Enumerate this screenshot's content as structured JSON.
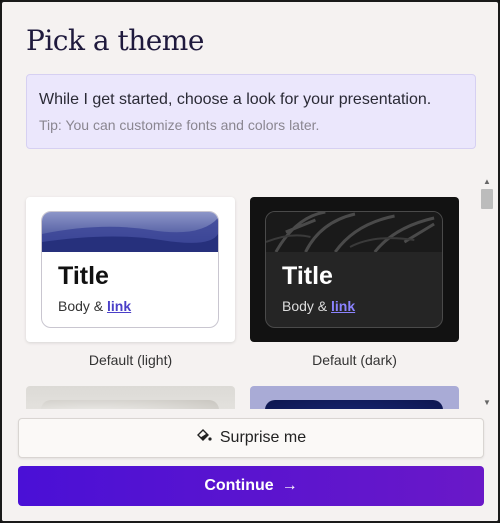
{
  "dialog": {
    "title": "Pick a theme"
  },
  "info": {
    "message": "While I get started, choose a look for your presentation.",
    "tip": "Tip: You can customize fonts and colors later."
  },
  "themes": [
    {
      "name": "Default (light)",
      "sample_title": "Title",
      "body_prefix": "Body & ",
      "link": "link",
      "accent": "#3b3f9a"
    },
    {
      "name": "Default (dark)",
      "sample_title": "Title",
      "body_prefix": "Body & ",
      "link": "link",
      "accent": "#2b2b2b"
    }
  ],
  "buttons": {
    "surprise_label": "Surprise me",
    "surprise_icon": "paint-bucket-icon",
    "continue_label": "Continue",
    "continue_icon": "arrow-right-icon"
  },
  "colors": {
    "primary": "#4a10d6",
    "panel_bg": "#f5f2f1",
    "info_bg": "#ebe7fc"
  }
}
